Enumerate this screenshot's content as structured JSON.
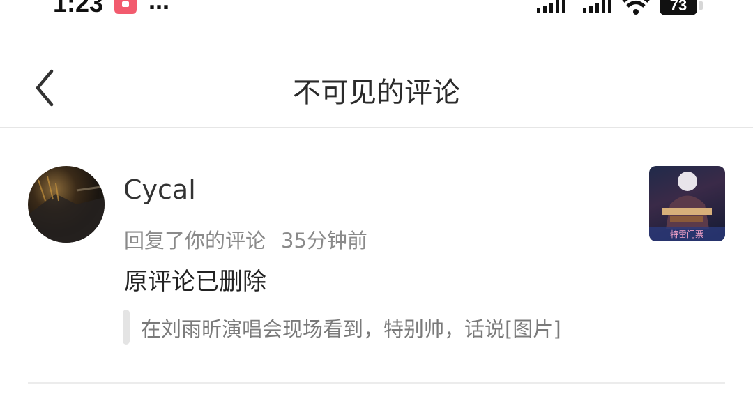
{
  "status_bar": {
    "time": "1:23",
    "dots": "…",
    "battery": "73"
  },
  "nav": {
    "title": "不可见的评论"
  },
  "notice": {
    "user_name": "Cycal",
    "action": "回复了你的评论",
    "time_ago": "35分钟前",
    "comment": "原评论已删除",
    "quote": "在刘雨昕演唱会现场看到，特别帅，话说[图片]",
    "thumbnail_caption": "特雷门票"
  },
  "colors": {
    "app_icon": "#f25b6e",
    "divider": "#e6e6e6",
    "secondary_text": "#8a8a8a"
  }
}
